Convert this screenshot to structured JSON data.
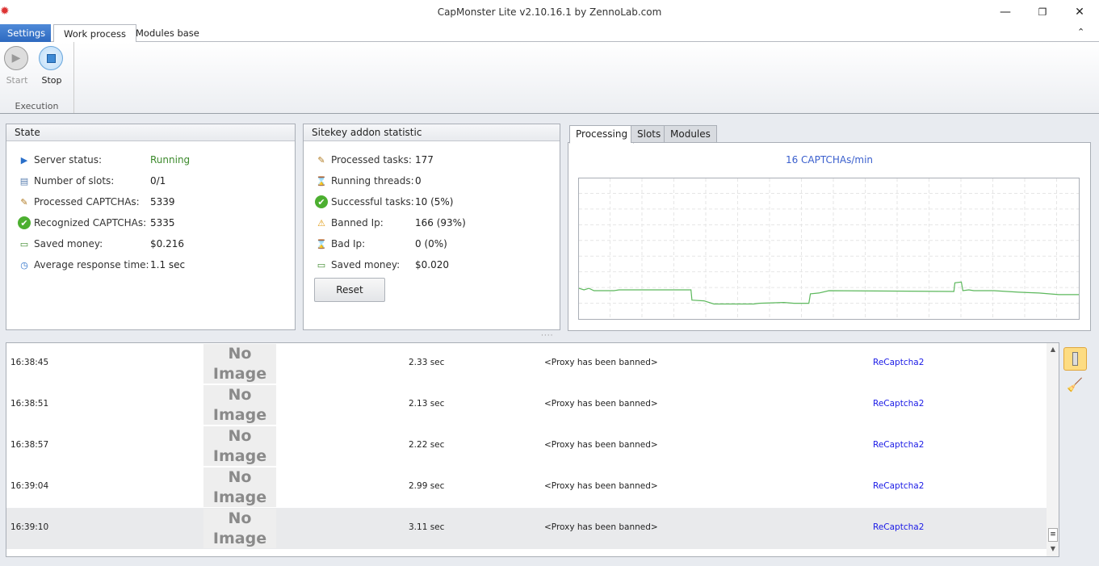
{
  "window": {
    "title": "CapMonster Lite v2.10.16.1 by ZennoLab.com",
    "minimize": "—",
    "maximize": "❐",
    "close": "✕"
  },
  "ribbon_tabs": [
    {
      "label": "Settings"
    },
    {
      "label": "Work process"
    },
    {
      "label": "Modules base"
    }
  ],
  "ribbon": {
    "start_label": "Start",
    "stop_label": "Stop",
    "group_label": "Execution",
    "collapse": "⌃"
  },
  "state": {
    "title": "State",
    "rows": [
      {
        "label": "Server status:",
        "value": "Running",
        "icon": "play-circle-icon"
      },
      {
        "label": "Number of slots:",
        "value": "0/1",
        "icon": "slots-icon"
      },
      {
        "label": "Processed CAPTCHAs:",
        "value": "5339",
        "icon": "notepad-icon"
      },
      {
        "label": "Recognized CAPTCHAs:",
        "value": "5335",
        "icon": "check-icon"
      },
      {
        "label": "Saved money:",
        "value": "$0.216",
        "icon": "money-icon"
      },
      {
        "label": "Average response time:",
        "value": "1.1 sec",
        "icon": "clock-icon"
      }
    ]
  },
  "sitekey": {
    "title": "Sitekey addon statistic",
    "reset_label": "Reset",
    "rows": [
      {
        "label": "Processed tasks:",
        "value": "177",
        "icon": "notepad-icon"
      },
      {
        "label": "Running threads:",
        "value": "0",
        "icon": "hourglass-icon"
      },
      {
        "label": "Successful tasks:",
        "value": "10 (5%)",
        "icon": "check-icon"
      },
      {
        "label": "Banned Ip:",
        "value": "166 (93%)",
        "icon": "warning-icon"
      },
      {
        "label": "Bad Ip:",
        "value": "0 (0%)",
        "icon": "hourglass-icon"
      },
      {
        "label": "Saved money:",
        "value": "$0.020",
        "icon": "money-icon"
      }
    ]
  },
  "chart_tabs": [
    {
      "label": "Processing"
    },
    {
      "label": "Slots"
    },
    {
      "label": "Modules"
    }
  ],
  "chart_data": {
    "type": "line",
    "title": "16 CAPTCHAs/min",
    "xlabel": "",
    "ylabel": "",
    "xlim": [
      0,
      100
    ],
    "ylim": [
      0,
      9
    ],
    "grid": true,
    "color": "#5cb85c",
    "series": [
      {
        "name": "CAPTCHAs/min",
        "x": [
          0,
          1,
          2,
          3,
          7,
          8,
          22.4,
          22.6,
          25,
          27,
          35,
          36,
          41,
          43,
          46,
          46.3,
          48,
          50,
          75,
          75.2,
          76.5,
          76.8,
          78,
          79,
          83,
          88,
          92,
          96,
          100
        ],
        "y": [
          1.95,
          1.85,
          1.95,
          1.8,
          1.8,
          1.85,
          1.85,
          1.2,
          1.15,
          0.95,
          0.95,
          1.0,
          1.05,
          1.0,
          1.0,
          1.6,
          1.65,
          1.8,
          1.75,
          2.3,
          2.35,
          1.8,
          1.85,
          1.8,
          1.8,
          1.7,
          1.65,
          1.55,
          1.55
        ]
      }
    ]
  },
  "log": {
    "no_image": "No Image",
    "rows": [
      {
        "time": "16:38:45",
        "duration": "2.33 sec",
        "message": "<Proxy has been banned>",
        "type": "ReCaptcha2"
      },
      {
        "time": "16:38:51",
        "duration": "2.13 sec",
        "message": "<Proxy has been banned>",
        "type": "ReCaptcha2"
      },
      {
        "time": "16:38:57",
        "duration": "2.22 sec",
        "message": "<Proxy has been banned>",
        "type": "ReCaptcha2"
      },
      {
        "time": "16:39:04",
        "duration": "2.99 sec",
        "message": "<Proxy has been banned>",
        "type": "ReCaptcha2"
      },
      {
        "time": "16:39:10",
        "duration": "3.11 sec",
        "message": "<Proxy has been banned>",
        "type": "ReCaptcha2"
      }
    ]
  }
}
